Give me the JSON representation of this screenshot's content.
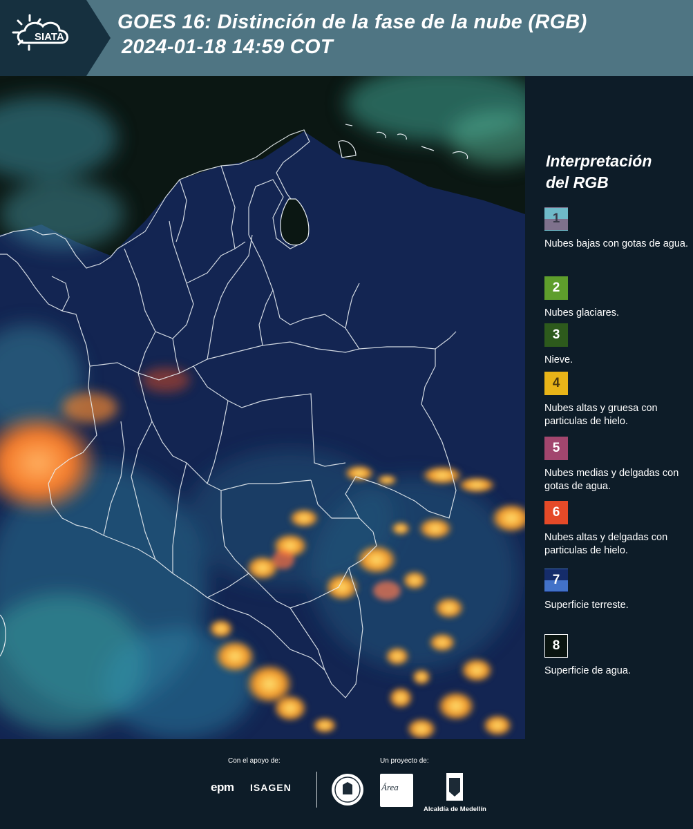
{
  "header": {
    "logo_text": "SIATA",
    "title_line1": "GOES 16: Distinción de la fase de la nube (RGB)",
    "title_line2": "2024-01-18 14:59 COT",
    "bg_color": "#4f7583"
  },
  "legend": {
    "title_line1": "Interpretación",
    "title_line2": "del RGB",
    "items": [
      {
        "num": "1",
        "label": "Nubes bajas con gotas de agua.",
        "color_top": "#6fbac9",
        "color_bottom": "#7e718c",
        "num_color": "#3a3a4a"
      },
      {
        "num": "2",
        "label": "Nubes glaciares.",
        "color_top": "#5e9e2c",
        "color_bottom": "#5e9e2c",
        "num_color": "#ffffff"
      },
      {
        "num": "3",
        "label": "Nieve.",
        "color_top": "#2d5a1c",
        "color_bottom": "#2d5a1c",
        "num_color": "#ffffff"
      },
      {
        "num": "4",
        "label": "Nubes altas y gruesa con particulas de hielo.",
        "color_top": "#e8b418",
        "color_bottom": "#e8b418",
        "num_color": "#4a3a10"
      },
      {
        "num": "5",
        "label": "Nubes medias y delgadas con gotas de agua.",
        "color_top": "#a2466e",
        "color_bottom": "#a2466e",
        "num_color": "#ffffff"
      },
      {
        "num": "6",
        "label": "Nubes altas y delgadas con particulas de hielo.",
        "color_top": "#e54a28",
        "color_bottom": "#e54a28",
        "num_color": "#ffffff"
      },
      {
        "num": "7",
        "label": "Superficie terreste.",
        "color_top": "#152c6a",
        "color_bottom": "#4272c8",
        "num_color": "#ffffff"
      },
      {
        "num": "8",
        "label": "Superficie de agua.",
        "color_top": "#0a1410",
        "color_bottom": "#0a1410",
        "num_color": "#ffffff",
        "border": "#ffffff"
      }
    ]
  },
  "footer": {
    "support_label": "Con el apoyo de:",
    "project_label": "Un proyecto de:",
    "sponsor1": "epm",
    "sponsor2": "ISAGEN",
    "partner_area": "Área",
    "partner_alcaldia": "Alcaldía de Medellín"
  }
}
